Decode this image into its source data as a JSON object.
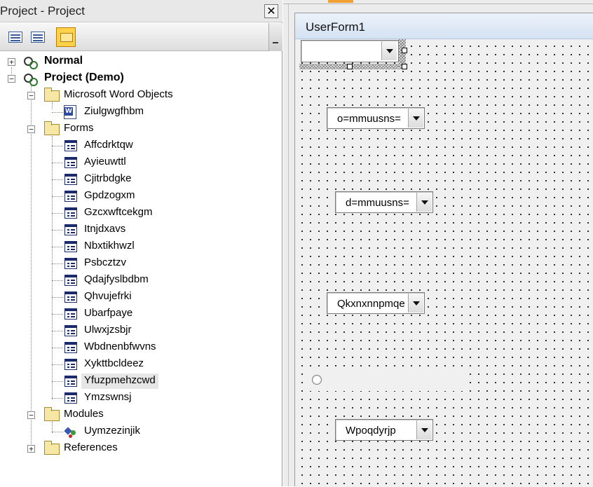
{
  "project_pane": {
    "title": "Project - Project",
    "close_glyph": "✕",
    "toolbar": {
      "view_code_icon": "view-code-icon",
      "view_object_icon": "view-object-icon",
      "toggle_folders_icon": "folder-icon"
    }
  },
  "tree": {
    "normal": "Normal",
    "project": "Project (Demo)",
    "word_objects_folder": "Microsoft Word Objects",
    "document": "Ziulgwgfhbm",
    "forms_folder": "Forms",
    "forms": [
      "Affcdrktqw",
      "Ayieuwttl",
      "Cjitrbdgke",
      "Gpdzogxm",
      "Gzcxwftcekgm",
      "Itnjdxavs",
      "Nbxtikhwzl",
      "Psbcztzv",
      "Qdajfyslbdbm",
      "Qhvujefrki",
      "Ubarfpaye",
      "Ulwxjzsbjr",
      "Wbdnenbfwvns",
      "Xykttbcldeez",
      "Yfuzpmehzcwd",
      "Ymzswnsj"
    ],
    "selected_form": "Yfuzpmehzcwd",
    "modules_folder": "Modules",
    "module": "Uymzezinjik",
    "references_folder": "References",
    "expanders": {
      "collapsed": "+",
      "expanded": "−"
    }
  },
  "userform": {
    "title": "UserForm1",
    "combo_selected_text": "",
    "combo1_text": "o=mmuusns=",
    "combo2_text": "d=mmuusns=",
    "combo3_text": "Qkxnxnnpmqe",
    "combo4_text": "Wpoqdyrjp"
  },
  "colors": {
    "toolbar_active": "#ffd24a",
    "titlebar": "#d4e2f2",
    "accent": "#f0a030"
  }
}
